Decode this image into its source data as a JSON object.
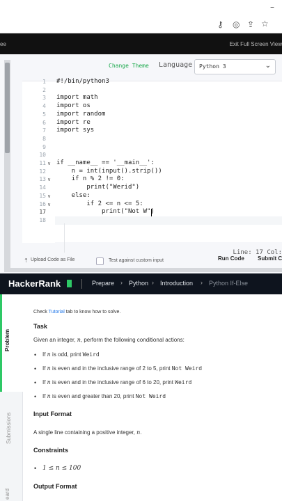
{
  "browser": {
    "icons": [
      "key-icon",
      "eye-off-icon",
      "share-icon",
      "star-icon",
      "profile-icon"
    ]
  },
  "fullscreen_bar": {
    "left_text": "ee",
    "exit_label": "Exit Full Screen View"
  },
  "editor": {
    "change_theme": "Change Theme",
    "language_label": "Language",
    "language_value": "Python 3",
    "status": "Line: 17 Col:",
    "code_lines": [
      {
        "n": "1",
        "text": "#!/bin/python3"
      },
      {
        "n": "2",
        "text": ""
      },
      {
        "n": "3",
        "text": "import math"
      },
      {
        "n": "4",
        "text": "import os"
      },
      {
        "n": "5",
        "text": "import random"
      },
      {
        "n": "6",
        "text": "import re"
      },
      {
        "n": "7",
        "text": "import sys"
      },
      {
        "n": "8",
        "text": ""
      },
      {
        "n": "9",
        "text": ""
      },
      {
        "n": "10",
        "text": ""
      },
      {
        "n": "11",
        "text": "if __name__ == '__main__':"
      },
      {
        "n": "12",
        "text": "    n = int(input().strip())"
      },
      {
        "n": "13",
        "text": "    if n % 2 != 0:"
      },
      {
        "n": "14",
        "text": "        print(\"Werid\")"
      },
      {
        "n": "15",
        "text": "    else:"
      },
      {
        "n": "16",
        "text": "        if 2 <= n <= 5:"
      },
      {
        "n": "17",
        "text": "            print(\"Not W\")"
      },
      {
        "n": "18",
        "text": ""
      }
    ],
    "upload_label": "Upload Code as File",
    "custom_input_label": "Test against custom input",
    "run_label": "Run Code",
    "submit_label": "Submit Co"
  },
  "nav": {
    "logo": "HackerRank",
    "crumbs": [
      "Prepare",
      "Python",
      "Introduction",
      "Python If-Else"
    ]
  },
  "tabs": {
    "problem": "Problem",
    "submissions": "Submissions",
    "discussions": "eard"
  },
  "problem": {
    "check_prefix": "Check ",
    "check_link": "Tutorial",
    "check_suffix": " tab to know how to solve.",
    "task_heading": "Task",
    "task_intro_a": "Given an integer, ",
    "task_intro_var": "n",
    "task_intro_b": ", perform the following conditional actions:",
    "bullets": [
      {
        "pre": "If ",
        "var": "n",
        "mid": " is odd, print ",
        "code": "Weird"
      },
      {
        "pre": "If ",
        "var": "n",
        "mid": " is even and in the inclusive range of 2 to 5, print ",
        "code": "Not Weird"
      },
      {
        "pre": "If ",
        "var": "n",
        "mid": " is even and in the inclusive range of 6 to 20, print ",
        "code": "Weird"
      },
      {
        "pre": "If ",
        "var": "n",
        "mid": " is even and greater than 20, print ",
        "code": "Not Weird"
      }
    ],
    "input_heading": "Input Format",
    "input_text_a": "A single line containing a positive integer, ",
    "input_text_var": "n",
    "input_text_b": ".",
    "constraints_heading": "Constraints",
    "constraint": "1 ≤ n ≤ 100",
    "output_heading": "Output Format"
  },
  "colors": {
    "accent_green": "#2ec866",
    "nav_bg": "#0e141e",
    "link_blue": "#1a73e8"
  }
}
